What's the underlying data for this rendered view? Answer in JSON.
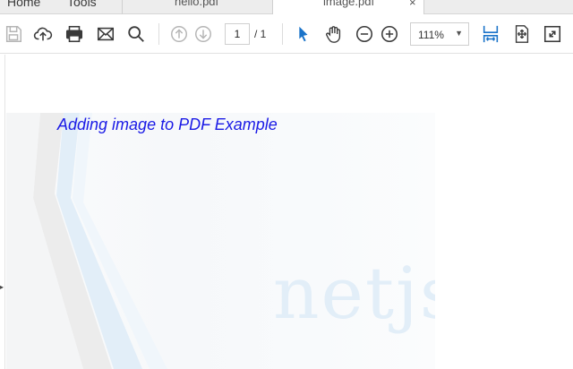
{
  "tabs": {
    "home_label": "Home",
    "tools_label": "Tools",
    "documents": [
      {
        "label": "hello.pdf",
        "active": false
      },
      {
        "label": "image.pdf",
        "active": true
      }
    ],
    "close_glyph": "×"
  },
  "toolbar": {
    "icons": [
      "save-icon",
      "upload-icon",
      "print-icon",
      "email-icon",
      "search-icon",
      "prev-page-icon",
      "next-page-icon",
      "select-tool-icon",
      "hand-tool-icon",
      "zoom-out-icon",
      "zoom-in-icon",
      "fit-width-icon",
      "fit-page-icon",
      "fullscreen-icon"
    ],
    "page_current": "1",
    "page_total": "/ 1",
    "zoom": "111%",
    "accent": "#1a73c9"
  },
  "document": {
    "heading": "Adding image to PDF Example",
    "heading_color": "#1a1ae6",
    "watermark": "netjs"
  },
  "sidebar": {
    "toggle_glyph": "▸"
  }
}
